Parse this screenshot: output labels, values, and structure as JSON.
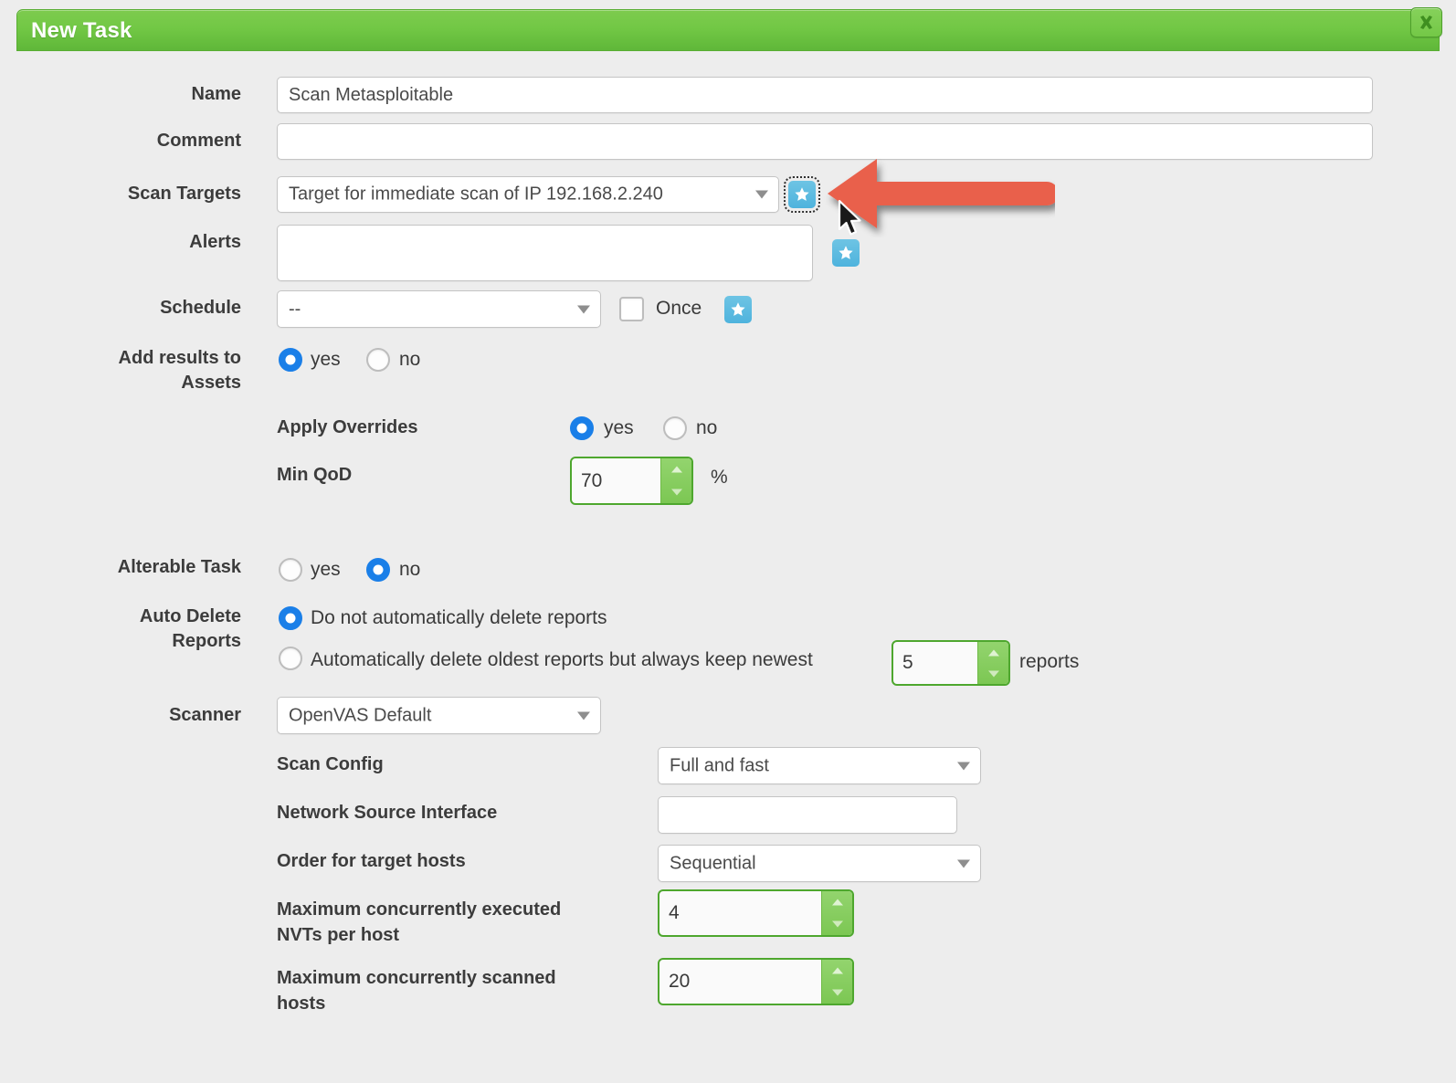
{
  "dialog": {
    "title": "New Task",
    "close_label": "close",
    "header_color": "#6fc243",
    "accent_blue": "#4eb3dd",
    "accent_green": "#4ea72e",
    "radio_blue": "#1a7fe8"
  },
  "fields": {
    "name": {
      "label": "Name",
      "value": "Scan Metasploitable",
      "placeholder": ""
    },
    "comment": {
      "label": "Comment",
      "value": "",
      "placeholder": ""
    },
    "scan_targets": {
      "label": "Scan Targets",
      "value": "Target for immediate scan of IP 192.168.2.240",
      "new_button": "new-target"
    },
    "alerts": {
      "label": "Alerts",
      "value": "",
      "new_button": "new-alert"
    },
    "schedule": {
      "label": "Schedule",
      "value": "--",
      "once_label": "Once",
      "once_checked": false,
      "new_button": "new-schedule"
    },
    "add_results_to_assets": {
      "label": "Add results to Assets",
      "label_line1": "Add results to",
      "label_line2": "Assets",
      "options": [
        "yes",
        "no"
      ],
      "selected": "yes"
    },
    "apply_overrides": {
      "label": "Apply Overrides",
      "options": [
        "yes",
        "no"
      ],
      "selected": "yes"
    },
    "min_qod": {
      "label": "Min QoD",
      "value": "70",
      "unit": "%"
    },
    "alterable_task": {
      "label": "Alterable Task",
      "options": [
        "yes",
        "no"
      ],
      "selected": "no"
    },
    "auto_delete_reports": {
      "label": "Auto Delete Reports",
      "label_line1": "Auto Delete",
      "label_line2": "Reports",
      "option_keep_label": "Do not automatically delete reports",
      "option_delete_label": "Automatically delete oldest reports but always keep newest",
      "keep_count": "5",
      "reports_suffix": "reports",
      "selected": "keep"
    },
    "scanner": {
      "label": "Scanner",
      "value": "OpenVAS Default"
    },
    "scan_config": {
      "label": "Scan Config",
      "value": "Full and fast"
    },
    "network_source_interface": {
      "label": "Network Source Interface",
      "value": "",
      "placeholder": ""
    },
    "order_for_target_hosts": {
      "label": "Order for target hosts",
      "value": "Sequential"
    },
    "max_nvts_per_host": {
      "label": "Maximum concurrently executed NVTs per host",
      "label_line1": "Maximum concurrently executed",
      "label_line2": "NVTs per host",
      "value": "4"
    },
    "max_scanned_hosts": {
      "label": "Maximum concurrently scanned hosts",
      "label_line1": "Maximum concurrently scanned",
      "label_line2": "hosts",
      "value": "20"
    }
  },
  "annotation": {
    "arrow_color": "#e9604b",
    "arrow_direction": "left",
    "points_at": "scan-targets-new-button"
  }
}
